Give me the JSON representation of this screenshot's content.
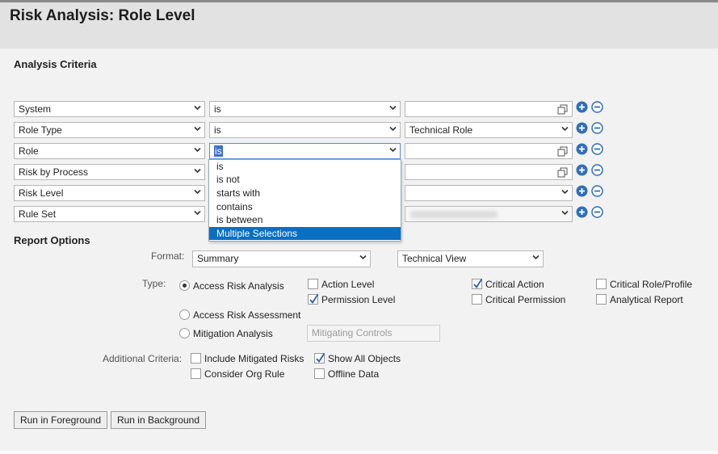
{
  "page": {
    "title": "Risk Analysis: Role Level"
  },
  "analysis": {
    "title": "Analysis Criteria",
    "rows": [
      {
        "field": "System",
        "operator": "is",
        "value": "",
        "value_type": "picker"
      },
      {
        "field": "Role Type",
        "operator": "is",
        "value": "Technical Role",
        "value_type": "select"
      },
      {
        "field": "Role",
        "operator": "is",
        "value": "",
        "value_type": "picker"
      },
      {
        "field": "Risk by Process",
        "operator": "is",
        "value": "",
        "value_type": "picker"
      },
      {
        "field": "Risk Level",
        "operator": "is",
        "value": "",
        "value_type": "select"
      },
      {
        "field": "Rule Set",
        "operator": "is",
        "value": "",
        "value_type": "select-blurred"
      }
    ],
    "operator_dropdown": {
      "options": [
        "is",
        "is not",
        "starts with",
        "contains",
        "is between",
        "Multiple Selections"
      ],
      "highlighted": "Multiple Selections"
    }
  },
  "report_options": {
    "title": "Report Options",
    "format_label": "Format:",
    "format_value": "Summary",
    "view_value": "Technical View",
    "type_label": "Type:",
    "types": [
      {
        "label": "Access Risk Analysis",
        "selected": true
      },
      {
        "label": "Access Risk Assessment",
        "selected": false
      },
      {
        "label": "Mitigation Analysis",
        "selected": false
      }
    ],
    "mitigating_placeholder": "Mitigating Controls",
    "level_checks": [
      {
        "label": "Action Level",
        "checked": false
      },
      {
        "label": "Permission Level",
        "checked": true
      },
      {
        "label": "Critical Action",
        "checked": true
      },
      {
        "label": "Critical Permission",
        "checked": false
      },
      {
        "label": "Critical Role/Profile",
        "checked": false
      },
      {
        "label": "Analytical Report",
        "checked": false
      }
    ],
    "additional_label": "Additional Criteria:",
    "additional_checks": [
      {
        "label": "Include Mitigated Risks",
        "checked": false
      },
      {
        "label": "Show All Objects",
        "checked": true
      },
      {
        "label": "Consider Org Rule",
        "checked": false
      },
      {
        "label": "Offline Data",
        "checked": false
      }
    ]
  },
  "buttons": {
    "foreground": "Run in Foreground",
    "background": "Run in Background"
  },
  "colors": {
    "add_remove_icon": "#2f6fb6",
    "selection": "#0a6fc2"
  }
}
